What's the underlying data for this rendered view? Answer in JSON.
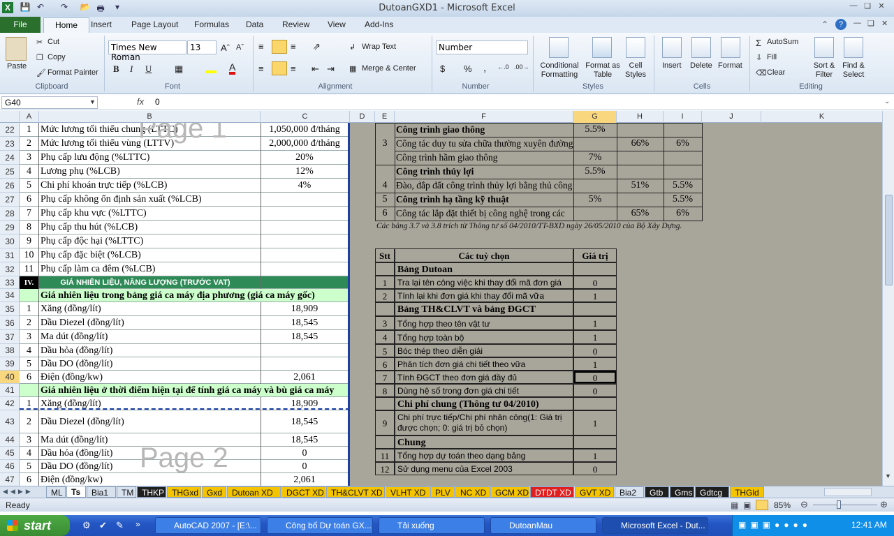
{
  "window": {
    "title": "DutoanGXD1 - Microsoft Excel",
    "app_icon": "X"
  },
  "ribbon_tabs": [
    "File",
    "Home",
    "Insert",
    "Page Layout",
    "Formulas",
    "Data",
    "Review",
    "View",
    "Add-Ins"
  ],
  "clipboard": {
    "paste": "Paste",
    "cut": "Cut",
    "copy": "Copy",
    "format_painter": "Format Painter",
    "label": "Clipboard"
  },
  "font": {
    "name": "Times New Roman",
    "size": "13",
    "label": "Font"
  },
  "alignment": {
    "wrap": "Wrap Text",
    "merge": "Merge & Center",
    "label": "Alignment"
  },
  "number": {
    "format": "Number",
    "currency": "$",
    "percent": "%",
    "comma": ",",
    "label": "Number"
  },
  "styles": {
    "cond": "Conditional Formatting",
    "table": "Format as Table",
    "cell": "Cell Styles",
    "label": "Styles"
  },
  "cells": {
    "insert": "Insert",
    "delete": "Delete",
    "format": "Format",
    "label": "Cells"
  },
  "editing": {
    "autosum": "AutoSum",
    "fill": "Fill",
    "clear": "Clear",
    "sort": "Sort & Filter",
    "find": "Find & Select",
    "label": "Editing"
  },
  "formula_bar": {
    "name_box": "G40",
    "fx": "fx",
    "value": "0"
  },
  "columns": [
    "A",
    "B",
    "C",
    "D",
    "E",
    "F",
    "G",
    "H",
    "I",
    "J",
    "K"
  ],
  "rows": [
    "22",
    "23",
    "24",
    "25",
    "26",
    "27",
    "28",
    "29",
    "30",
    "31",
    "32",
    "33",
    "34",
    "35",
    "36",
    "37",
    "38",
    "39",
    "40",
    "41",
    "42",
    "43",
    "44",
    "45",
    "46",
    "47"
  ],
  "watermarks": {
    "page1": "Page 1",
    "page2": "Page 2"
  },
  "left_table": [
    {
      "a": "1",
      "b": "Mức lương tối thiểu chung (LTTC)",
      "c": "1,050,000 đ/tháng"
    },
    {
      "a": "2",
      "b": "Mức lương tối thiểu vùng (LTTV)",
      "c": "2,000,000 đ/tháng"
    },
    {
      "a": "3",
      "b": "Phụ cấp lưu động (%LTTC)",
      "c": "20%"
    },
    {
      "a": "4",
      "b": "Lương phụ (%LCB)",
      "c": "12%"
    },
    {
      "a": "5",
      "b": "Chi phí khoán trực tiếp (%LCB)",
      "c": "4%"
    },
    {
      "a": "6",
      "b": "Phụ cấp không ổn định sản xuất (%LCB)",
      "c": ""
    },
    {
      "a": "7",
      "b": "Phụ cấp khu vực (%LTTC)",
      "c": ""
    },
    {
      "a": "8",
      "b": "Phụ cấp thu hút (%LCB)",
      "c": ""
    },
    {
      "a": "9",
      "b": "Phụ cấp độc hại (%LTTC)",
      "c": ""
    },
    {
      "a": "10",
      "b": "Phụ cấp đặc biệt (%LCB)",
      "c": ""
    },
    {
      "a": "11",
      "b": "Phụ cấp làm ca đêm (%LCB)",
      "c": ""
    },
    {
      "a": "IV.",
      "b": "GIÁ NHIÊN LIỆU, NĂNG LƯỢNG (TRƯỚC VAT)",
      "c": ""
    },
    {
      "a": "",
      "b": "Giá nhiên liệu trong bảng giá ca máy địa phương (giá ca máy gốc)",
      "c": ""
    },
    {
      "a": "1",
      "b": "Xăng (đồng/lít)",
      "c": "18,909"
    },
    {
      "a": "2",
      "b": "Dầu Diezel (đồng/lít)",
      "c": "18,545"
    },
    {
      "a": "3",
      "b": "Ma dút (đồng/lít)",
      "c": "18,545"
    },
    {
      "a": "4",
      "b": "Dầu hỏa (đồng/lít)",
      "c": ""
    },
    {
      "a": "5",
      "b": "Dầu DO (đồng/lít)",
      "c": ""
    },
    {
      "a": "6",
      "b": "Điện (đồng/kw)",
      "c": "2,061"
    },
    {
      "a": "",
      "b": "Giá nhiên liệu ở thời điểm hiện tại để tính giá ca máy và bù giá ca máy",
      "c": ""
    },
    {
      "a": "1",
      "b": "Xăng (đồng/lít)",
      "c": "18,909"
    },
    {
      "a": "2",
      "b": "Dầu Diezel (đồng/lít)",
      "c": "18,545"
    },
    {
      "a": "3",
      "b": "Ma dút (đồng/lít)",
      "c": "18,545"
    },
    {
      "a": "4",
      "b": "Dầu hỏa (đồng/lít)",
      "c": "0"
    },
    {
      "a": "5",
      "b": "Dầu DO (đồng/lít)",
      "c": "0"
    },
    {
      "a": "6",
      "b": "Điện (đồng/kw)",
      "c": "2,061"
    }
  ],
  "right_top": [
    {
      "e": "",
      "f": "Công trình giao thông",
      "g": "5.5%",
      "h": "",
      "i": ""
    },
    {
      "e": "3",
      "f": "Công tác duy tu sửa chữa thường xuyên  đường",
      "g": "",
      "h": "66%",
      "i": "6%"
    },
    {
      "e": "",
      "f": "Công trình hầm giao thông",
      "g": "7%",
      "h": "",
      "i": ""
    },
    {
      "e": "",
      "f": "Công trình thủy lợi",
      "g": "5.5%",
      "h": "",
      "i": ""
    },
    {
      "e": "4",
      "f": "Đào, đắp đất công trình thủy lợi bằng thủ công",
      "g": "",
      "h": "51%",
      "i": "5.5%"
    },
    {
      "e": "5",
      "f": "Công trình hạ tầng kỹ thuật",
      "g": "5%",
      "h": "",
      "i": "5.5%"
    },
    {
      "e": "6",
      "f": "Công tác lắp đặt thiết bị công nghệ trong các",
      "g": "",
      "h": "65%",
      "i": "6%"
    }
  ],
  "note": "Các bảng 3.7 và 3.8 trích từ Thông tư số 04/2010/TT-BXD ngày 26/05/2010 của Bộ Xây Dựng.",
  "options": {
    "headers": [
      "Stt",
      "Các tuỳ chọn",
      "Giá trị"
    ],
    "rows": [
      {
        "stt": "",
        "label": "Bảng Dutoan",
        "val": "",
        "bold": true
      },
      {
        "stt": "1",
        "label": "Tra lại tên công việc khi thay đổi mã đơn giá",
        "val": "0"
      },
      {
        "stt": "2",
        "label": "Tính lại khi đơn giá khi thay đổi mã vữa",
        "val": "1"
      },
      {
        "stt": "",
        "label": "Bảng TH&CLVT và bảng ĐGCT",
        "val": "",
        "bold": true
      },
      {
        "stt": "3",
        "label": "Tổng hợp theo tên vật tư",
        "val": "1"
      },
      {
        "stt": "4",
        "label": "Tổng hợp toàn bộ",
        "val": "1"
      },
      {
        "stt": "5",
        "label": "Bóc thép theo diễn giải",
        "val": "0"
      },
      {
        "stt": "6",
        "label": "Phân tích đơn giá chi tiết theo vữa",
        "val": "1"
      },
      {
        "stt": "7",
        "label": "Tính ĐGCT theo đơn giá đầy đủ",
        "val": "0"
      },
      {
        "stt": "8",
        "label": "Dùng hệ số trong đơn giá chi tiết",
        "val": "0"
      },
      {
        "stt": "",
        "label": "Chi phí chung (Thông tư 04/2010)",
        "val": "",
        "bold": true
      },
      {
        "stt": "9",
        "label": "Chi phí trực tiếp/Chi phí nhân công(1: Giá trị",
        "label2": "được chọn; 0: giá trị bỏ chọn)",
        "val": "1"
      },
      {
        "stt": "",
        "label": "Chung",
        "val": "",
        "bold": true
      },
      {
        "stt": "11",
        "label": "Tổng hợp dự toán theo dạng bảng",
        "val": "1"
      },
      {
        "stt": "12",
        "label": "Sử dụng menu của Excel 2003",
        "val": "0"
      }
    ]
  },
  "sheet_tabs": [
    {
      "name": "ML",
      "color": "#d8e2ef"
    },
    {
      "name": "Ts",
      "color": "#ffffff"
    },
    {
      "name": "Bia1",
      "color": "#d8e2ef"
    },
    {
      "name": "TM",
      "color": "#d8e2ef"
    },
    {
      "name": "THKP",
      "color": "#1f1f1f"
    },
    {
      "name": "THGxd",
      "color": "#f5c400"
    },
    {
      "name": "Gxd",
      "color": "#f5c400"
    },
    {
      "name": "Dutoan XD",
      "color": "#f5c400"
    },
    {
      "name": "DGCT XD",
      "color": "#f5c400"
    },
    {
      "name": "TH&CLVT XD",
      "color": "#f5c400"
    },
    {
      "name": "VLHT XD",
      "color": "#f5c400"
    },
    {
      "name": "PLV",
      "color": "#f5c400"
    },
    {
      "name": "NC XD",
      "color": "#f5c400"
    },
    {
      "name": "GCM XD",
      "color": "#f5c400"
    },
    {
      "name": "DTDT XD",
      "color": "#e02020"
    },
    {
      "name": "GVT XD",
      "color": "#f5c400"
    },
    {
      "name": "Bia2",
      "color": "#d8e2ef"
    },
    {
      "name": "Gtb",
      "color": "#1f1f1f"
    },
    {
      "name": "Gms",
      "color": "#1f1f1f"
    },
    {
      "name": "Gdtcg",
      "color": "#1f1f1f"
    },
    {
      "name": "THGld",
      "color": "#f5c400"
    }
  ],
  "status": {
    "ready": "Ready",
    "zoom": "85%"
  },
  "taskbar": {
    "start": "start",
    "items": [
      "AutoCAD 2007 - [E:\\...",
      "Công bố Dự toán GX...",
      "Tải xuống",
      "DutoanMau",
      "Microsoft Excel - Dut..."
    ],
    "clock": "12:41 AM"
  }
}
